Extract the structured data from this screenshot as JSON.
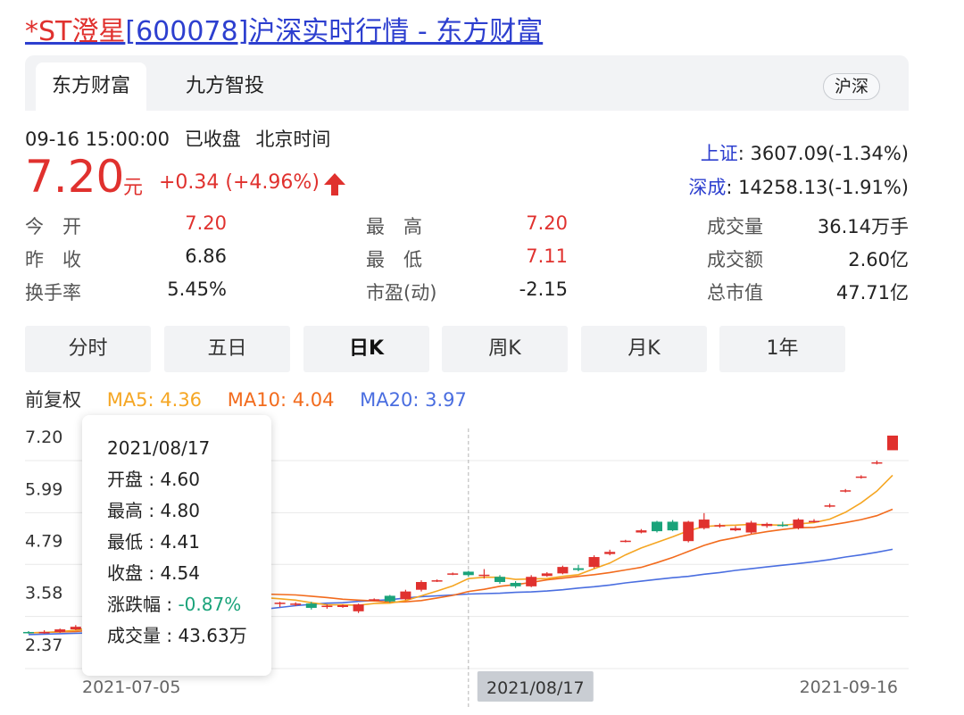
{
  "page_title": {
    "code_part": "*ST澄星",
    "rest_part": "[600078]沪深实时行情 - 东方财富"
  },
  "tabs": [
    {
      "label": "东方财富",
      "active": true
    },
    {
      "label": "九方智投",
      "active": false
    }
  ],
  "market_badge": "沪深",
  "status": {
    "time": "09-16 15:00:00",
    "state": "已收盘",
    "zone": "北京时间"
  },
  "quote": {
    "price": "7.20",
    "unit": "元",
    "change": "+0.34 (+4.96%)",
    "up_color": "#e0312e",
    "down_color": "#1aa37a"
  },
  "indices": [
    {
      "name": "上证",
      "value": ": 3607.09(-1.34%)"
    },
    {
      "name": "深成",
      "value": ": 14258.13(-1.91%)"
    }
  ],
  "stats": {
    "col1": [
      {
        "label": "今　开",
        "value": "7.20",
        "red": true
      },
      {
        "label": "昨　收",
        "value": "6.86",
        "red": false
      },
      {
        "label": "换手率",
        "value": "5.45%",
        "red": false
      }
    ],
    "col2": [
      {
        "label": "最　高",
        "value": "7.20",
        "red": true
      },
      {
        "label": "最　低",
        "value": "7.11",
        "red": true
      },
      {
        "label": "市盈(动)",
        "value": "-2.15",
        "red": false
      }
    ],
    "col3": [
      {
        "label": "成交量",
        "value": "36.14万手",
        "red": false
      },
      {
        "label": "成交额",
        "value": "2.60亿",
        "red": false
      },
      {
        "label": "总市值",
        "value": "47.71亿",
        "red": false
      }
    ]
  },
  "period_buttons": [
    {
      "label": "分时",
      "active": false
    },
    {
      "label": "五日",
      "active": false
    },
    {
      "label": "日K",
      "active": true
    },
    {
      "label": "周K",
      "active": false
    },
    {
      "label": "月K",
      "active": false
    },
    {
      "label": "1年",
      "active": false
    }
  ],
  "legend": {
    "adjust": "前复权",
    "ma5": {
      "text": "MA5: 4.36",
      "color": "#f5a623"
    },
    "ma10": {
      "text": "MA10: 4.04",
      "color": "#f26b1d"
    },
    "ma20": {
      "text": "MA20: 3.97",
      "color": "#4a6ee0"
    }
  },
  "tooltip": {
    "date": "2021/08/17",
    "open": "开盘 : 4.60",
    "high": "最高 : 4.80",
    "low": "最低 : 4.41",
    "close": "收盘 : 4.54",
    "change_label": "涨跌幅 : ",
    "change_value": "-0.87%",
    "volume": "成交量 : 43.63万"
  },
  "chart_data": {
    "type": "candlestick",
    "y_ticks": [
      "7.20",
      "5.99",
      "4.79",
      "3.58",
      "2.37"
    ],
    "ylim": [
      2.37,
      7.2
    ],
    "x_labels": [
      "2021-07-05",
      "2021-09-16"
    ],
    "crosshair_label": "2021/08/17",
    "crosshair_index": 28,
    "grid": true,
    "candles": [
      [
        2.64,
        2.62,
        2.66,
        2.6
      ],
      [
        2.62,
        2.64,
        2.68,
        2.6
      ],
      [
        2.64,
        2.7,
        2.72,
        2.62
      ],
      [
        2.7,
        2.76,
        2.8,
        2.68
      ],
      [
        2.8,
        2.94,
        2.98,
        2.78
      ],
      [
        3.05,
        3.2,
        3.24,
        3.02
      ],
      [
        3.25,
        3.4,
        3.44,
        3.22
      ],
      [
        3.45,
        3.58,
        3.62,
        3.42
      ],
      [
        3.62,
        3.64,
        3.66,
        3.6
      ],
      [
        3.96,
        3.75,
        4.0,
        3.7
      ],
      [
        3.7,
        3.6,
        3.76,
        3.52
      ],
      [
        3.55,
        3.5,
        3.58,
        3.45
      ],
      [
        3.42,
        3.44,
        3.48,
        3.4
      ],
      [
        3.46,
        3.48,
        3.52,
        3.44
      ],
      [
        3.7,
        3.5,
        3.72,
        3.45
      ],
      [
        3.35,
        3.3,
        3.4,
        3.25
      ],
      [
        3.3,
        3.32,
        3.34,
        3.22
      ],
      [
        3.28,
        3.3,
        3.33,
        3.24
      ],
      [
        3.3,
        3.2,
        3.34,
        3.16
      ],
      [
        3.22,
        3.25,
        3.28,
        3.18
      ],
      [
        3.22,
        3.26,
        3.28,
        3.2
      ],
      [
        3.12,
        3.28,
        3.3,
        3.08
      ],
      [
        3.38,
        3.4,
        3.42,
        3.36
      ],
      [
        3.48,
        3.35,
        3.5,
        3.32
      ],
      [
        3.4,
        3.58,
        3.62,
        3.38
      ],
      [
        3.62,
        3.8,
        3.84,
        3.58
      ],
      [
        3.82,
        3.84,
        3.86,
        3.8
      ],
      [
        3.98,
        4.0,
        4.02,
        3.96
      ],
      [
        4.04,
        3.96,
        4.06,
        3.92
      ],
      [
        3.95,
        3.97,
        4.1,
        3.88
      ],
      [
        3.92,
        3.8,
        3.96,
        3.76
      ],
      [
        3.78,
        3.7,
        3.82,
        3.66
      ],
      [
        3.7,
        3.92,
        3.96,
        3.68
      ],
      [
        3.94,
        4.0,
        4.03,
        3.92
      ],
      [
        4.0,
        4.15,
        4.18,
        3.98
      ],
      [
        4.12,
        4.08,
        4.2,
        4.05
      ],
      [
        4.15,
        4.38,
        4.42,
        4.12
      ],
      [
        4.45,
        4.5,
        4.55,
        4.42
      ],
      [
        4.74,
        4.76,
        4.78,
        4.72
      ],
      [
        4.95,
        5.0,
        5.03,
        4.93
      ],
      [
        5.2,
        4.98,
        5.22,
        4.95
      ],
      [
        5.2,
        5.0,
        5.24,
        4.98
      ],
      [
        4.75,
        5.2,
        5.22,
        4.72
      ],
      [
        5.05,
        5.25,
        5.4,
        5.02
      ],
      [
        5.1,
        5.12,
        5.16,
        5.06
      ],
      [
        5.0,
        5.05,
        5.1,
        4.98
      ],
      [
        4.95,
        5.18,
        5.22,
        4.92
      ],
      [
        5.1,
        5.15,
        5.18,
        5.06
      ],
      [
        5.13,
        5.1,
        5.2,
        5.08
      ],
      [
        5.05,
        5.25,
        5.28,
        5.02
      ],
      [
        5.2,
        5.22,
        5.26,
        5.18
      ],
      [
        5.55,
        5.58,
        5.62,
        5.53
      ],
      [
        5.9,
        5.93,
        5.96,
        5.88
      ],
      [
        6.22,
        6.25,
        6.28,
        6.2
      ],
      [
        6.55,
        6.58,
        6.62,
        6.53
      ],
      [
        6.86,
        7.2,
        7.2,
        7.11
      ]
    ],
    "ma5": [
      2.62,
      2.63,
      2.65,
      2.68,
      2.74,
      2.85,
      3.01,
      3.18,
      3.35,
      3.51,
      3.59,
      3.61,
      3.59,
      3.55,
      3.5,
      3.44,
      3.41,
      3.38,
      3.32,
      3.27,
      3.27,
      3.26,
      3.3,
      3.31,
      3.37,
      3.48,
      3.59,
      3.71,
      3.88,
      3.91,
      3.91,
      3.86,
      3.87,
      3.88,
      3.93,
      3.97,
      4.11,
      4.24,
      4.43,
      4.59,
      4.72,
      4.85,
      4.99,
      5.09,
      5.11,
      5.12,
      5.14,
      5.13,
      5.12,
      5.15,
      5.18,
      5.26,
      5.42,
      5.64,
      5.91,
      6.28
    ],
    "ma10": [
      2.62,
      2.63,
      2.64,
      2.65,
      2.68,
      2.74,
      2.82,
      2.92,
      3.02,
      3.14,
      3.24,
      3.34,
      3.42,
      3.49,
      3.52,
      3.52,
      3.51,
      3.5,
      3.47,
      3.44,
      3.4,
      3.38,
      3.36,
      3.33,
      3.34,
      3.37,
      3.43,
      3.49,
      3.58,
      3.63,
      3.7,
      3.74,
      3.79,
      3.85,
      3.89,
      3.93,
      3.97,
      4.02,
      4.08,
      4.14,
      4.25,
      4.37,
      4.51,
      4.65,
      4.76,
      4.83,
      4.91,
      4.97,
      5.02,
      5.06,
      5.07,
      5.12,
      5.18,
      5.25,
      5.34,
      5.49
    ],
    "ma20": [
      2.58,
      2.59,
      2.6,
      2.61,
      2.62,
      2.64,
      2.67,
      2.71,
      2.76,
      2.81,
      2.87,
      2.94,
      3.01,
      3.07,
      3.12,
      3.17,
      3.21,
      3.25,
      3.28,
      3.31,
      3.32,
      3.35,
      3.37,
      3.39,
      3.43,
      3.46,
      3.48,
      3.5,
      3.52,
      3.53,
      3.54,
      3.56,
      3.57,
      3.59,
      3.62,
      3.66,
      3.69,
      3.73,
      3.78,
      3.82,
      3.86,
      3.9,
      3.93,
      3.98,
      4.02,
      4.07,
      4.11,
      4.15,
      4.19,
      4.23,
      4.27,
      4.32,
      4.38,
      4.43,
      4.49,
      4.56
    ]
  }
}
